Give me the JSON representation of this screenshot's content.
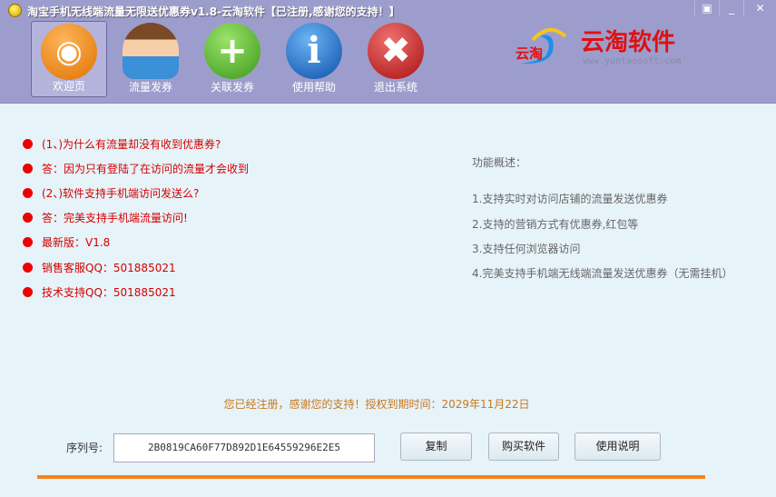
{
  "window": {
    "title": "淘宝手机无线端流量无限送优惠券v1.8-云淘软件【已注册,感谢您的支持！】",
    "controls": [
      "restore",
      "minimize",
      "close"
    ]
  },
  "toolbar": [
    {
      "label": "欢迎页",
      "icon": "rss-icon",
      "selected": true
    },
    {
      "label": "流量发券",
      "icon": "user-icon"
    },
    {
      "label": "关联发券",
      "icon": "plus-icon"
    },
    {
      "label": "使用帮助",
      "icon": "info-icon"
    },
    {
      "label": "退出系统",
      "icon": "close-icon"
    }
  ],
  "logo": {
    "name": "云淘软件",
    "mark": "云淘",
    "url": "www.yuntaosoft.com"
  },
  "faq": [
    "(1、)为什么有流量却没有收到优惠券?",
    "答：因为只有登陆了在访问的流量才会收到",
    "(2、)软件支持手机端访问发送么?",
    "答：完美支持手机端流量访问!",
    "最新版：V1.8",
    "销售客服QQ：501885021",
    "技术支持QQ：501885021"
  ],
  "features": {
    "title": "功能概述：",
    "items": [
      "1.支持实时对访问店铺的流量发送优惠券",
      "2.支持的营销方式有优惠券,红包等",
      "3.支持任何浏览器访问",
      "4.完美支持手机端无线端流量发送优惠券（无需挂机）"
    ]
  },
  "registration": "您已经注册，感谢您的支持！授权到期时间：2029年11月22日",
  "serial": {
    "label": "序列号:",
    "value": "2B0819CA60F77D892D1E64559296E2E5"
  },
  "buttons": {
    "copy": "复制",
    "buy": "购买软件",
    "manual": "使用说明"
  }
}
